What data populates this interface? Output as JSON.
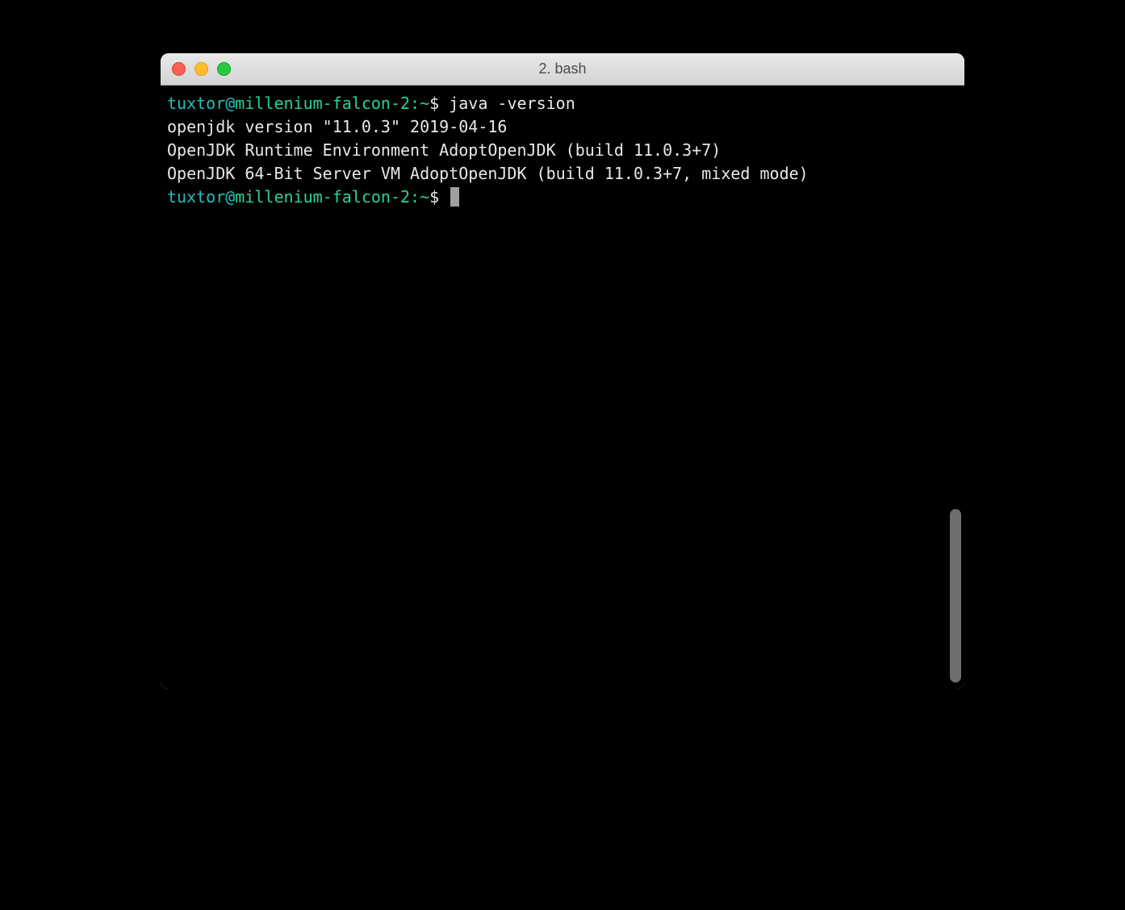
{
  "window": {
    "title": "2. bash"
  },
  "terminal": {
    "lines": [
      {
        "type": "prompt",
        "user": "tuxtor",
        "at": "@",
        "host": "millenium-falcon-2",
        "colon": ":",
        "path": "~",
        "dollar": "$",
        "command": " java -version"
      },
      {
        "type": "output",
        "text": "openjdk version \"11.0.3\" 2019-04-16"
      },
      {
        "type": "output",
        "text": "OpenJDK Runtime Environment AdoptOpenJDK (build 11.0.3+7)"
      },
      {
        "type": "output",
        "text": "OpenJDK 64-Bit Server VM AdoptOpenJDK (build 11.0.3+7, mixed mode)"
      },
      {
        "type": "prompt",
        "user": "tuxtor",
        "at": "@",
        "host": "millenium-falcon-2",
        "colon": ":",
        "path": "~",
        "dollar": "$",
        "command": " ",
        "cursor": true
      }
    ]
  }
}
